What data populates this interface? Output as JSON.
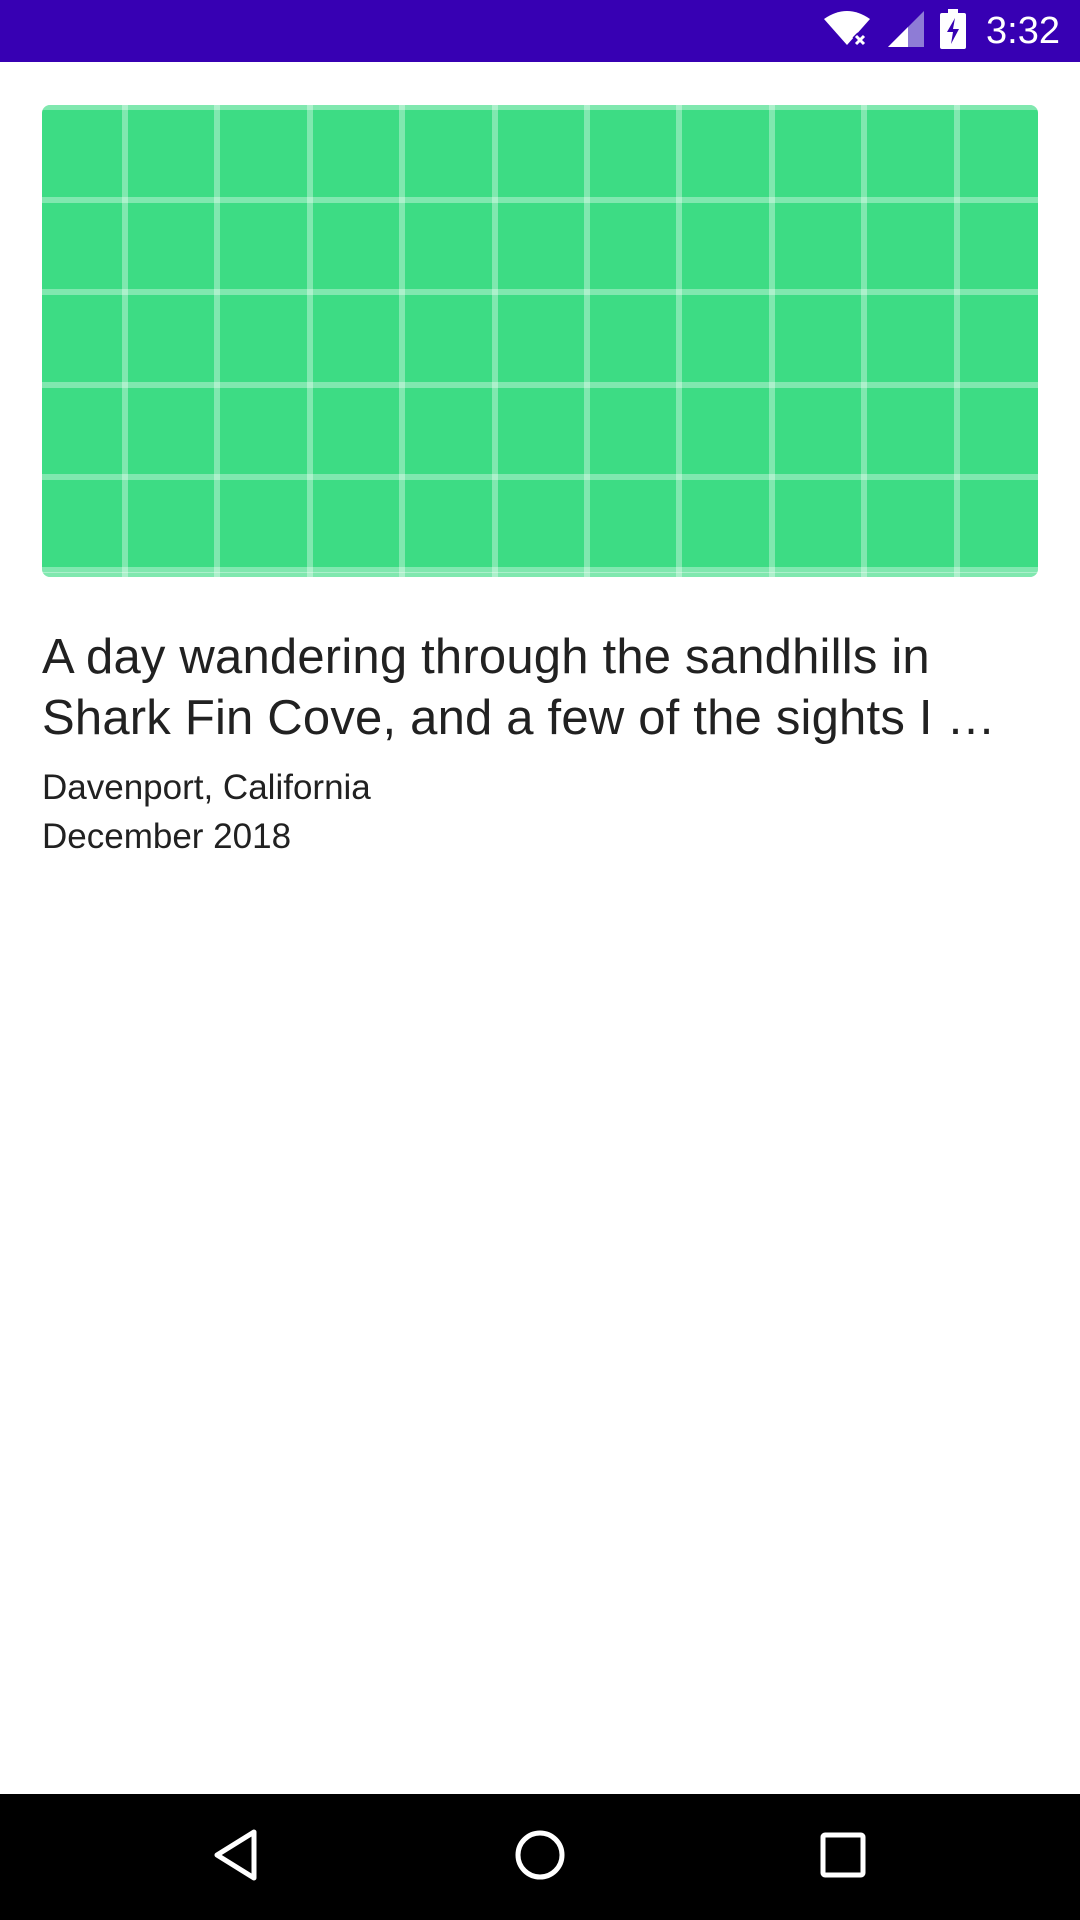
{
  "status_bar": {
    "time": "3:32",
    "icons": [
      "wifi-off-icon",
      "cellular-signal-icon",
      "battery-charging-icon"
    ],
    "background_color": "#3700b3"
  },
  "card": {
    "image": {
      "icon": "image-placeholder-grid",
      "color": "#3ddc84"
    },
    "title": "A day wandering through the sandhills in Shark Fin Cove, and a few of the sights I …",
    "location": "Davenport, California",
    "date": "December 2018"
  },
  "nav_bar": {
    "buttons": [
      "back-icon",
      "home-icon",
      "recents-icon"
    ]
  }
}
